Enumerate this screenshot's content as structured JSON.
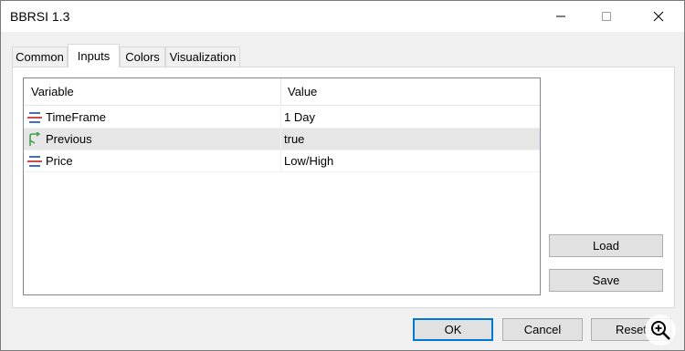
{
  "window": {
    "title": "BBRSI 1.3"
  },
  "tabs": [
    {
      "label": "Common"
    },
    {
      "label": "Inputs"
    },
    {
      "label": "Colors"
    },
    {
      "label": "Visualization"
    }
  ],
  "active_tab": "Inputs",
  "grid": {
    "columns": [
      "Variable",
      "Value"
    ],
    "rows": [
      {
        "variable": "TimeFrame",
        "value": "1 Day",
        "icon": "enum-icon"
      },
      {
        "variable": "Previous",
        "value": "true",
        "icon": "bool-icon"
      },
      {
        "variable": "Price",
        "value": "Low/High",
        "icon": "enum-icon"
      }
    ],
    "selected_row": 1
  },
  "side_buttons": {
    "load": "Load",
    "save": "Save"
  },
  "footer_buttons": {
    "ok": "OK",
    "cancel": "Cancel",
    "reset": "Reset"
  },
  "colors": {
    "accent": "#0078d7",
    "enum_icon_blue": "#3d6fd1",
    "enum_icon_red": "#d24a4a",
    "bool_icon_green": "#3aa14a"
  }
}
